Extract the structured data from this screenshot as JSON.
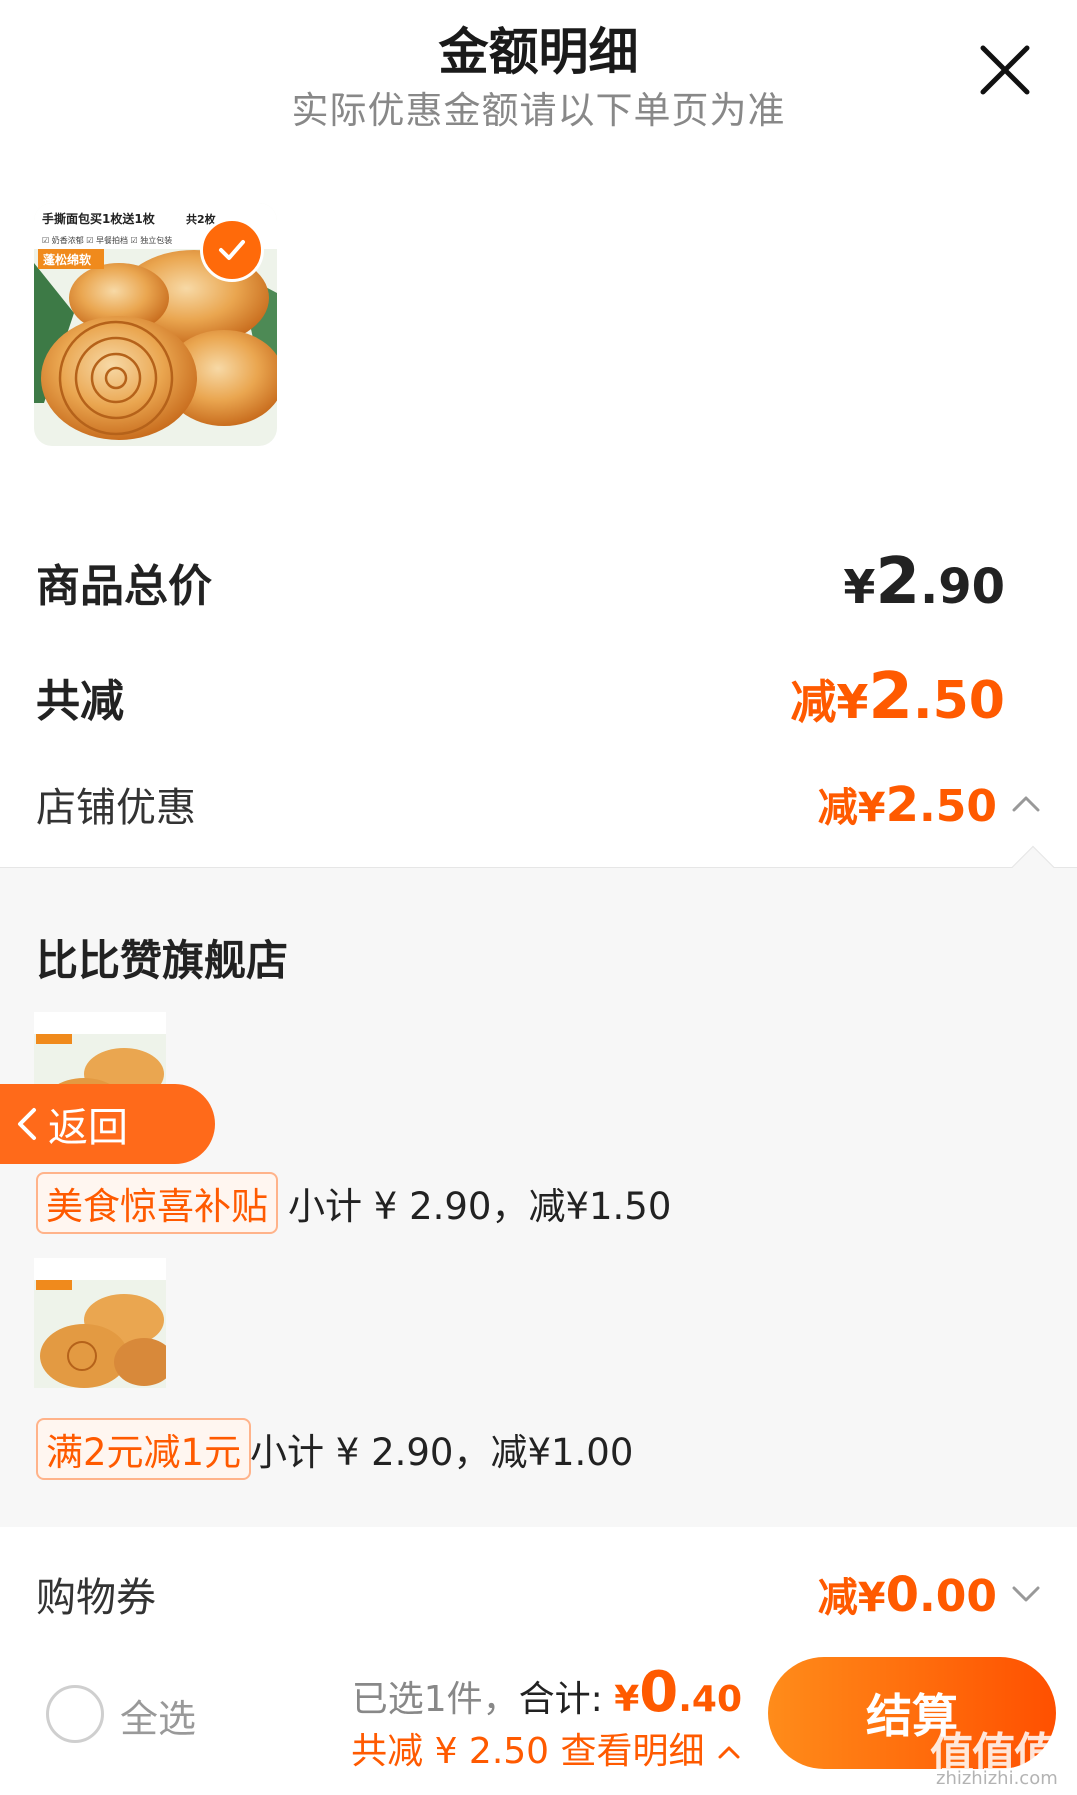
{
  "header": {
    "title": "金额明细",
    "subtitle": "实际优惠金额请以下单页为准"
  },
  "product_image": {
    "caption_title": "手撕面包买1枚送1枚",
    "caption_count": "共2枚",
    "caption_features": "☑ 奶香浓郁  ☑ 早餐拍档  ☑ 独立包装",
    "caption_badge": "蓬松绵软"
  },
  "summary": {
    "goods_total_label": "商品总价",
    "goods_total_symbol": "¥",
    "goods_total_int": "2",
    "goods_total_dec": ".90",
    "total_reduction_label": "共减",
    "total_reduction_value_prefix": "减¥",
    "total_reduction_int": "2",
    "total_reduction_dec": ".50",
    "store_discount_label": "店铺优惠",
    "store_discount_prefix": "减¥",
    "store_discount_int": "2",
    "store_discount_dec": ".50"
  },
  "store_detail": {
    "shop_name": "比比赞旗舰店",
    "items": [
      {
        "tag": "美食惊喜补贴",
        "subtotal": "小计 ¥ 2.90，减¥1.50"
      },
      {
        "tag": "满2元减1元",
        "subtotal": "小计 ¥ 2.90，减¥1.00"
      }
    ]
  },
  "back_button": {
    "label": "返回"
  },
  "coupon": {
    "label": "购物券",
    "prefix": "减¥",
    "int": "0",
    "dec": ".00"
  },
  "bottom_bar": {
    "select_all": "全选",
    "selected_count": "已选1件，",
    "total_label": "合计: ",
    "total_symbol": "¥",
    "total_int": "0",
    "total_dec": ".40",
    "reduction_text": "共减 ¥ 2.50  查看明细",
    "checkout": "结算"
  },
  "watermark": {
    "main": "值值值",
    "sub": "zhizhizhi.com"
  },
  "colors": {
    "accent": "#ff5a00",
    "panel_bg": "#f7f7f7"
  }
}
